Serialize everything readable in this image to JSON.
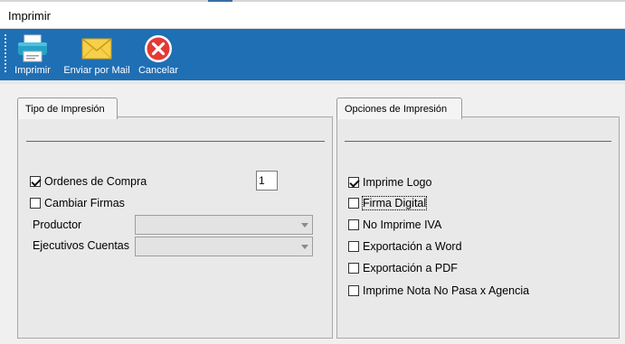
{
  "window": {
    "title": "Imprimir"
  },
  "toolbar": {
    "print_label": "Imprimir",
    "mail_label": "Enviar por Mail",
    "cancel_label": "Cancelar"
  },
  "tipo": {
    "tab_label": "Tipo de Impresión",
    "ordenes_label": "Ordenes de Compra",
    "ordenes_checked": true,
    "copies_value": "1",
    "cambiar_label": "Cambiar Firmas",
    "cambiar_checked": false,
    "productor_label": "Productor",
    "productor_value": "",
    "ejecutivos_label": "Ejecutivos Cuentas",
    "ejecutivos_value": ""
  },
  "opciones": {
    "tab_label": "Opciones de Impresión",
    "items": [
      {
        "label": "Imprime Logo",
        "checked": true
      },
      {
        "label": "Firma Digital",
        "checked": false
      },
      {
        "label": "No Imprime IVA",
        "checked": false
      },
      {
        "label": "Exportación a Word",
        "checked": false
      },
      {
        "label": "Exportación a PDF",
        "checked": false
      },
      {
        "label": "Imprime Nota No Pasa x Agencia",
        "checked": false
      }
    ]
  },
  "colors": {
    "toolbar_bg": "#1f6fb5",
    "separator": "#3a6ea5"
  },
  "icons": {
    "print": "printer-icon",
    "mail": "envelope-icon",
    "cancel": "cancel-icon"
  }
}
